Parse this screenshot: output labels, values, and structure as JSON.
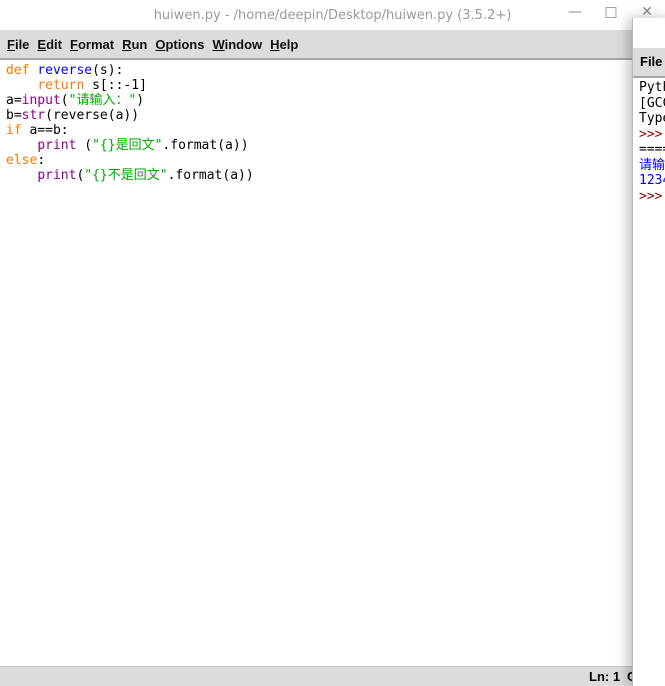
{
  "editor": {
    "title": "huiwen.py - /home/deepin/Desktop/huiwen.py (3.5.2+)",
    "window_buttons": [
      "—",
      "□",
      "✕"
    ],
    "menu": [
      "File",
      "Edit",
      "Format",
      "Run",
      "Options",
      "Window",
      "Help"
    ],
    "code": [
      [
        [
          "kw",
          "def "
        ],
        [
          "def",
          "reverse"
        ],
        [
          "",
          "(s):"
        ]
      ],
      [
        [
          "",
          "    "
        ],
        [
          "kw",
          "return"
        ],
        [
          "",
          " s[::-1]"
        ]
      ],
      [
        [
          "",
          "a="
        ],
        [
          "bi",
          "input"
        ],
        [
          "",
          "("
        ],
        [
          "str",
          "\"请输入：\""
        ],
        [
          "",
          ")"
        ]
      ],
      [
        [
          "",
          "b="
        ],
        [
          "bi",
          "str"
        ],
        [
          "",
          "(reverse(a))"
        ]
      ],
      [
        [
          "kw",
          "if"
        ],
        [
          "",
          " a==b:"
        ]
      ],
      [
        [
          "",
          "    "
        ],
        [
          "bi",
          "print"
        ],
        [
          "",
          " ("
        ],
        [
          "str",
          "\"{}是回文\""
        ],
        [
          "",
          ".format(a))"
        ]
      ],
      [
        [
          "kw",
          "else"
        ],
        [
          "",
          ":"
        ]
      ],
      [
        [
          "",
          "    "
        ],
        [
          "bi",
          "print"
        ],
        [
          "",
          "("
        ],
        [
          "str",
          "\"{}不是回文\""
        ],
        [
          "",
          ".format(a))"
        ]
      ]
    ],
    "status": {
      "line": "Ln: 1",
      "col": "C"
    }
  },
  "shell": {
    "menu_first": "File",
    "lines": [
      [
        "",
        "Pyth"
      ],
      [
        "",
        "[GCC"
      ],
      [
        "",
        "Type"
      ],
      [
        "pr",
        ">>> "
      ],
      [
        "",
        "===="
      ],
      [
        "bl",
        "请输"
      ],
      [
        "bl",
        "1234"
      ],
      [
        "pr",
        ">>> "
      ]
    ]
  }
}
